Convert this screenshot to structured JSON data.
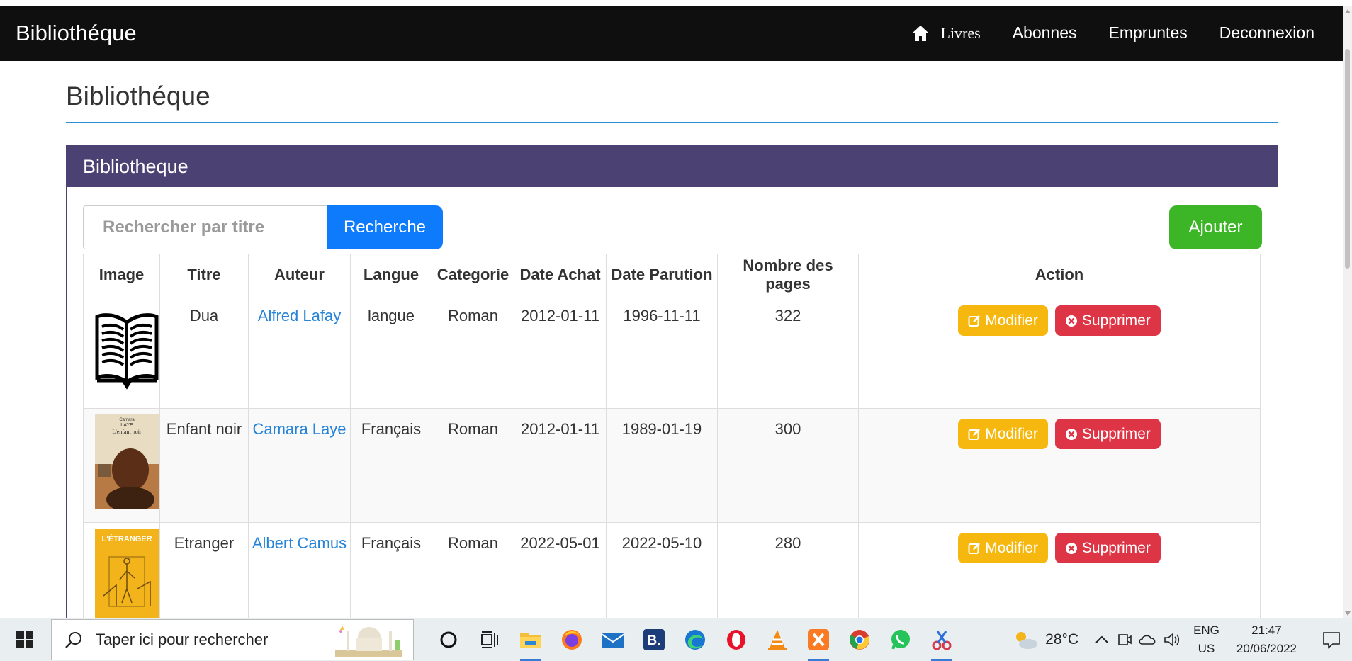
{
  "navbar": {
    "brand": "Bibliothéque",
    "links": [
      "Livres",
      "Abonnes",
      "Empruntes",
      "Deconnexion"
    ]
  },
  "page": {
    "title": "Bibliothéque"
  },
  "panel": {
    "heading": "Bibliotheque",
    "search_placeholder": "Rechercher par titre",
    "search_button": "Recherche",
    "add_button": "Ajouter"
  },
  "table": {
    "headers": [
      "Image",
      "Titre",
      "Auteur",
      "Langue",
      "Categorie",
      "Date Achat",
      "Date Parution",
      "Nombre des pages",
      "Action"
    ],
    "rows": [
      {
        "titre": "Dua",
        "auteur": "Alfred Lafay",
        "langue": "langue",
        "categorie": "Roman",
        "date_achat": "2012-01-11",
        "date_parution": "1996-11-11",
        "pages": "322",
        "cover": "open-book-icon"
      },
      {
        "titre": "Enfant noir",
        "auteur": "Camara Laye",
        "langue": "Français",
        "categorie": "Roman",
        "date_achat": "2012-01-11",
        "date_parution": "1989-01-19",
        "pages": "300",
        "cover": "book-cover-enfant-noir",
        "cover_text": [
          "Camara",
          "LAYE",
          "L'enfant noir"
        ]
      },
      {
        "titre": "Etranger",
        "auteur": "Albert Camus",
        "langue": "Français",
        "categorie": "Roman",
        "date_achat": "2022-05-01",
        "date_parution": "2022-05-10",
        "pages": "280",
        "cover": "book-cover-etranger",
        "cover_text": [
          "L'ÉTRANGER"
        ]
      }
    ],
    "edit_label": "Modifier",
    "delete_label": "Supprimer"
  },
  "taskbar": {
    "search_placeholder": "Taper ici pour rechercher",
    "temperature": "28°C",
    "lang_line1": "ENG",
    "lang_line2": "US",
    "time": "21:47",
    "date": "20/06/2022"
  },
  "colors": {
    "navbar_bg": "#0f0f0f",
    "panel_head": "#4b4273",
    "search_btn": "#0d7bfb",
    "add_btn": "#3cb527",
    "edit_btn": "#f6b70e",
    "delete_btn": "#dd3545",
    "author_link": "#2684d8"
  }
}
